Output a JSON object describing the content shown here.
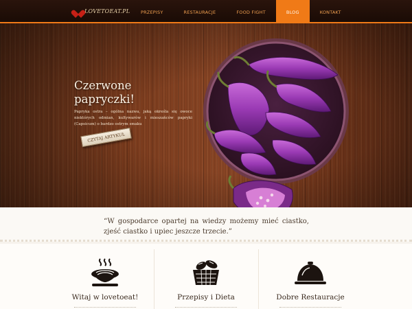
{
  "brand": {
    "logo_text": "LOVETOEAT.PL",
    "accent": "#f07a17"
  },
  "nav": {
    "items": [
      {
        "label": "Przepisy",
        "active": false
      },
      {
        "label": "Restauracje",
        "active": false
      },
      {
        "label": "Food Fight",
        "active": false
      },
      {
        "label": "Blog",
        "active": true
      },
      {
        "label": "Kontakt",
        "active": false
      }
    ]
  },
  "hero": {
    "title": "Czerwone papryczki!",
    "body": "Papryka ostra – ogólna nazwa, jaką określa się owoce niektórych odmian, kultywarów i mieszańców papryki (Capsicum) o bardzo ostrym smaku",
    "button_label": "Czytaj artykuł",
    "slides": {
      "count": 4,
      "active": 1
    }
  },
  "quote": {
    "text": "“W gospodarce opartej na wiedzy możemy mieć ciastko, zjeść ciastko i upiec jeszcze trzecie.”"
  },
  "features": [
    {
      "title": "Witaj w lovetoeat!",
      "icon": "pasta-bowl-icon"
    },
    {
      "title": "Przepisy i Dieta",
      "icon": "bread-basket-icon"
    },
    {
      "title": "Dobre Restauracje",
      "icon": "cloche-icon"
    }
  ]
}
